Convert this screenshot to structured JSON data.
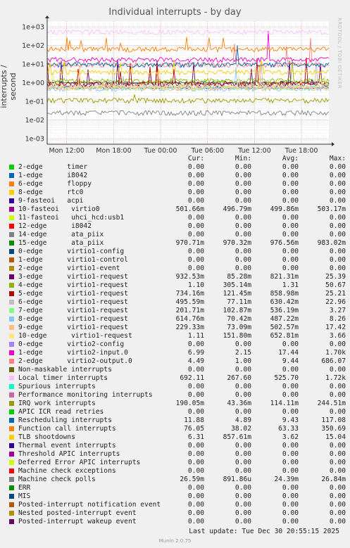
{
  "chart_data": {
    "type": "line",
    "title": "Individual interrupts - by day",
    "ylabel": "interrupts / second",
    "yscale": "log",
    "ylim": [
      0.0005,
      2000
    ],
    "yticks": [
      "1e+03",
      "1e+02",
      "1e+01",
      "1e+00",
      "1e-01",
      "1e-02",
      "1e-03"
    ],
    "ytick_values": [
      1000,
      100,
      10,
      1,
      0.1,
      0.01,
      0.001
    ],
    "xticks": [
      "Mon 12:00",
      "Mon 18:00",
      "Tue 00:00",
      "Tue 06:00",
      "Tue 12:00",
      "Tue 18:00"
    ],
    "xtick_hours": [
      12,
      18,
      24,
      30,
      36,
      42
    ],
    "xlim_hours": [
      9.5,
      45.5
    ],
    "grid": true,
    "legend_position": "bottom",
    "series": [
      {
        "name": "2-edge timer",
        "color": "#00cc00",
        "values": {
          "Cur": "0.00",
          "Min": "0.00",
          "Avg": "0.00",
          "Max": "0.00"
        }
      },
      {
        "name": "1-edge i8042",
        "color": "#0066b3",
        "values": {
          "Cur": "0.00",
          "Min": "0.00",
          "Avg": "0.00",
          "Max": "0.00"
        }
      },
      {
        "name": "6-edge floppy",
        "color": "#ff8000",
        "values": {
          "Cur": "0.00",
          "Min": "0.00",
          "Avg": "0.00",
          "Max": "0.00"
        }
      },
      {
        "name": "8-edge rtc0",
        "color": "#ffcc00",
        "values": {
          "Cur": "0.00",
          "Min": "0.00",
          "Avg": "0.00",
          "Max": "0.00"
        }
      },
      {
        "name": "9-fasteoi acpi",
        "color": "#330099",
        "values": {
          "Cur": "0.00",
          "Min": "0.00",
          "Avg": "0.00",
          "Max": "0.00"
        }
      },
      {
        "name": "10-fasteoi virtio0",
        "color": "#990099",
        "values": {
          "Cur": "501.66m",
          "Min": "496.79m",
          "Avg": "499.86m",
          "Max": "503.17m"
        }
      },
      {
        "name": "11-fasteoi uhci_hcd:usb1",
        "color": "#ccff00",
        "values": {
          "Cur": "0.00",
          "Min": "0.00",
          "Avg": "0.00",
          "Max": "0.00"
        }
      },
      {
        "name": "12-edge i8042",
        "color": "#ff0000",
        "values": {
          "Cur": "0.00",
          "Min": "0.00",
          "Avg": "0.00",
          "Max": "0.00"
        }
      },
      {
        "name": "14-edge ata_piix",
        "color": "#808080",
        "values": {
          "Cur": "0.00",
          "Min": "0.00",
          "Avg": "0.00",
          "Max": "0.00"
        }
      },
      {
        "name": "15-edge ata_piix",
        "color": "#008f00",
        "values": {
          "Cur": "970.71m",
          "Min": "970.32m",
          "Avg": "976.56m",
          "Max": "983.02m"
        }
      },
      {
        "name": "0-edge virtio1-config",
        "color": "#00487d",
        "values": {
          "Cur": "0.00",
          "Min": "0.00",
          "Avg": "0.00",
          "Max": "0.00"
        }
      },
      {
        "name": "1-edge virtio1-control",
        "color": "#b35a00",
        "values": {
          "Cur": "0.00",
          "Min": "0.00",
          "Avg": "0.00",
          "Max": "0.00"
        }
      },
      {
        "name": "2-edge virtio1-event",
        "color": "#b38f00",
        "values": {
          "Cur": "0.00",
          "Min": "0.00",
          "Avg": "0.00",
          "Max": "0.00"
        }
      },
      {
        "name": "3-edge virtio1-request",
        "color": "#6b006b",
        "values": {
          "Cur": "932.53m",
          "Min": "85.28m",
          "Avg": "821.31m",
          "Max": "25.39"
        }
      },
      {
        "name": "4-edge virtio1-request",
        "color": "#8fb300",
        "values": {
          "Cur": "1.10",
          "Min": "305.14m",
          "Avg": "1.31",
          "Max": "50.67"
        }
      },
      {
        "name": "5-edge virtio1-request",
        "color": "#b30000",
        "values": {
          "Cur": "734.16m",
          "Min": "121.45m",
          "Avg": "858.98m",
          "Max": "25.21"
        }
      },
      {
        "name": "6-edge virtio1-request",
        "color": "#bebebe",
        "values": {
          "Cur": "495.59m",
          "Min": "77.11m",
          "Avg": "630.42m",
          "Max": "22.96"
        }
      },
      {
        "name": "7-edge virtio1-request",
        "color": "#80ff80",
        "values": {
          "Cur": "201.71m",
          "Min": "102.87m",
          "Avg": "536.19m",
          "Max": "3.27"
        }
      },
      {
        "name": "8-edge virtio1-request",
        "color": "#80c9ff",
        "values": {
          "Cur": "614.76m",
          "Min": "70.42m",
          "Avg": "487.22m",
          "Max": "8.26"
        }
      },
      {
        "name": "9-edge virtio1-request",
        "color": "#ffc080",
        "values": {
          "Cur": "229.33m",
          "Min": "73.09m",
          "Avg": "502.57m",
          "Max": "17.42"
        }
      },
      {
        "name": "10-edge virtio1-request",
        "color": "#ffe680",
        "values": {
          "Cur": "1.11",
          "Min": "151.80m",
          "Avg": "652.81m",
          "Max": "3.66"
        }
      },
      {
        "name": "0-edge virtio2-config",
        "color": "#aa80ff",
        "values": {
          "Cur": "0.00",
          "Min": "0.00",
          "Avg": "0.00",
          "Max": "0.00"
        }
      },
      {
        "name": "1-edge virtio2-input.0",
        "color": "#ee00cc",
        "values": {
          "Cur": "6.99",
          "Min": "2.15",
          "Avg": "17.44",
          "Max": "1.70k"
        }
      },
      {
        "name": "2-edge virtio2-output.0",
        "color": "#ff8080",
        "values": {
          "Cur": "4.49",
          "Min": "1.00",
          "Avg": "9.44",
          "Max": "686.07"
        }
      },
      {
        "name": "Non-maskable interrupts",
        "color": "#666600",
        "values": {
          "Cur": "0.00",
          "Min": "0.00",
          "Avg": "0.00",
          "Max": "0.00"
        }
      },
      {
        "name": "Local timer interrupts",
        "color": "#ffbfff",
        "values": {
          "Cur": "692.11",
          "Min": "267.60",
          "Avg": "525.70",
          "Max": "1.72k"
        }
      },
      {
        "name": "Spurious interrupts",
        "color": "#00ffcc",
        "values": {
          "Cur": "0.00",
          "Min": "0.00",
          "Avg": "0.00",
          "Max": "0.00"
        }
      },
      {
        "name": "Performance monitoring interrupts",
        "color": "#cc6699",
        "values": {
          "Cur": "0.00",
          "Min": "0.00",
          "Avg": "0.00",
          "Max": "0.00"
        }
      },
      {
        "name": "IRQ work interrupts",
        "color": "#999900",
        "values": {
          "Cur": "190.05m",
          "Min": "43.36m",
          "Avg": "114.11m",
          "Max": "244.51m"
        }
      },
      {
        "name": "APIC ICR read retries",
        "color": "#00cc00",
        "values": {
          "Cur": "0.00",
          "Min": "0.00",
          "Avg": "0.00",
          "Max": "0.00"
        }
      },
      {
        "name": "Rescheduling interrupts",
        "color": "#0066b3",
        "values": {
          "Cur": "11.88",
          "Min": "4.89",
          "Avg": "9.43",
          "Max": "117.08"
        }
      },
      {
        "name": "Function call interrupts",
        "color": "#ff8000",
        "values": {
          "Cur": "76.05",
          "Min": "38.02",
          "Avg": "63.33",
          "Max": "350.69"
        }
      },
      {
        "name": "TLB shootdowns",
        "color": "#ffcc00",
        "values": {
          "Cur": "6.31",
          "Min": "857.61m",
          "Avg": "3.62",
          "Max": "15.04"
        }
      },
      {
        "name": "Thermal event interrupts",
        "color": "#330099",
        "values": {
          "Cur": "0.00",
          "Min": "0.00",
          "Avg": "0.00",
          "Max": "0.00"
        }
      },
      {
        "name": "Threshold APIC interrupts",
        "color": "#990099",
        "values": {
          "Cur": "0.00",
          "Min": "0.00",
          "Avg": "0.00",
          "Max": "0.00"
        }
      },
      {
        "name": "Deferred Error APIC interrupts",
        "color": "#ccff00",
        "values": {
          "Cur": "0.00",
          "Min": "0.00",
          "Avg": "0.00",
          "Max": "0.00"
        }
      },
      {
        "name": "Machine check exceptions",
        "color": "#ff0000",
        "values": {
          "Cur": "0.00",
          "Min": "0.00",
          "Avg": "0.00",
          "Max": "0.00"
        }
      },
      {
        "name": "Machine check polls",
        "color": "#808080",
        "values": {
          "Cur": "26.59m",
          "Min": "891.86u",
          "Avg": "24.39m",
          "Max": "26.84m"
        }
      },
      {
        "name": "ERR",
        "color": "#008f00",
        "values": {
          "Cur": "0.00",
          "Min": "0.00",
          "Avg": "0.00",
          "Max": "0.00"
        }
      },
      {
        "name": "MIS",
        "color": "#00487d",
        "values": {
          "Cur": "0.00",
          "Min": "0.00",
          "Avg": "0.00",
          "Max": "0.00"
        }
      },
      {
        "name": "Posted-interrupt notification event",
        "color": "#b35a00",
        "values": {
          "Cur": "0.00",
          "Min": "0.00",
          "Avg": "0.00",
          "Max": "0.00"
        }
      },
      {
        "name": "Nested posted-interrupt event",
        "color": "#b38f00",
        "values": {
          "Cur": "0.00",
          "Min": "0.00",
          "Avg": "0.00",
          "Max": "0.00"
        }
      },
      {
        "name": "Posted-interrupt wakeup event",
        "color": "#6b006b",
        "values": {
          "Cur": "0.00",
          "Min": "0.00",
          "Avg": "0.00",
          "Max": "0.00"
        }
      }
    ]
  },
  "legend": {
    "columns": [
      "Cur:",
      "Min:",
      "Avg:",
      "Max:"
    ],
    "rows": [
      {
        "label": "2-edge      timer",
        "color": "#00cc00",
        "cur": "0.00",
        "min": "0.00",
        "avg": "0.00",
        "max": "0.00"
      },
      {
        "label": "1-edge      i8042",
        "color": "#0066b3",
        "cur": "0.00",
        "min": "0.00",
        "avg": "0.00",
        "max": "0.00"
      },
      {
        "label": "6-edge      floppy",
        "color": "#ff8000",
        "cur": "0.00",
        "min": "0.00",
        "avg": "0.00",
        "max": "0.00"
      },
      {
        "label": "8-edge      rtc0",
        "color": "#ffcc00",
        "cur": "0.00",
        "min": "0.00",
        "avg": "0.00",
        "max": "0.00"
      },
      {
        "label": "9-fasteoi   acpi",
        "color": "#330099",
        "cur": "0.00",
        "min": "0.00",
        "avg": "0.00",
        "max": "0.00"
      },
      {
        "label": "10-fasteoi   virtio0",
        "color": "#990099",
        "cur": "501.66m",
        "min": "496.79m",
        "avg": "499.86m",
        "max": "503.17m"
      },
      {
        "label": "11-fasteoi   uhci_hcd:usb1",
        "color": "#ccff00",
        "cur": "0.00",
        "min": "0.00",
        "avg": "0.00",
        "max": "0.00"
      },
      {
        "label": "12-edge      i8042",
        "color": "#ff0000",
        "cur": "0.00",
        "min": "0.00",
        "avg": "0.00",
        "max": "0.00"
      },
      {
        "label": "14-edge      ata_piix",
        "color": "#808080",
        "cur": "0.00",
        "min": "0.00",
        "avg": "0.00",
        "max": "0.00"
      },
      {
        "label": "15-edge      ata_piix",
        "color": "#008f00",
        "cur": "970.71m",
        "min": "970.32m",
        "avg": "976.56m",
        "max": "983.02m"
      },
      {
        "label": "0-edge      virtio1-config",
        "color": "#00487d",
        "cur": "0.00",
        "min": "0.00",
        "avg": "0.00",
        "max": "0.00"
      },
      {
        "label": "1-edge      virtio1-control",
        "color": "#b35a00",
        "cur": "0.00",
        "min": "0.00",
        "avg": "0.00",
        "max": "0.00"
      },
      {
        "label": "2-edge      virtio1-event",
        "color": "#b38f00",
        "cur": "0.00",
        "min": "0.00",
        "avg": "0.00",
        "max": "0.00"
      },
      {
        "label": "3-edge      virtio1-request",
        "color": "#6b006b",
        "cur": "932.53m",
        "min": "85.28m",
        "avg": "821.31m",
        "max": "25.39"
      },
      {
        "label": "4-edge      virtio1-request",
        "color": "#8fb300",
        "cur": "1.10",
        "min": "305.14m",
        "avg": "1.31",
        "max": "50.67"
      },
      {
        "label": "5-edge      virtio1-request",
        "color": "#b30000",
        "cur": "734.16m",
        "min": "121.45m",
        "avg": "858.98m",
        "max": "25.21"
      },
      {
        "label": "6-edge      virtio1-request",
        "color": "#bebebe",
        "cur": "495.59m",
        "min": "77.11m",
        "avg": "630.42m",
        "max": "22.96"
      },
      {
        "label": "7-edge      virtio1-request",
        "color": "#80ff80",
        "cur": "201.71m",
        "min": "102.87m",
        "avg": "536.19m",
        "max": "3.27"
      },
      {
        "label": "8-edge      virtio1-request",
        "color": "#80c9ff",
        "cur": "614.76m",
        "min": "70.42m",
        "avg": "487.22m",
        "max": "8.26"
      },
      {
        "label": "9-edge      virtio1-request",
        "color": "#ffc080",
        "cur": "229.33m",
        "min": "73.09m",
        "avg": "502.57m",
        "max": "17.42"
      },
      {
        "label": "10-edge      virtio1-request",
        "color": "#ffe680",
        "cur": "1.11",
        "min": "151.80m",
        "avg": "652.81m",
        "max": "3.66"
      },
      {
        "label": "0-edge      virtio2-config",
        "color": "#aa80ff",
        "cur": "0.00",
        "min": "0.00",
        "avg": "0.00",
        "max": "0.00"
      },
      {
        "label": "1-edge      virtio2-input.0",
        "color": "#ee00cc",
        "cur": "6.99",
        "min": "2.15",
        "avg": "17.44",
        "max": "1.70k"
      },
      {
        "label": "2-edge      virtio2-output.0",
        "color": "#ff8080",
        "cur": "4.49",
        "min": "1.00",
        "avg": "9.44",
        "max": "686.07"
      },
      {
        "label": "Non-maskable interrupts",
        "color": "#666600",
        "cur": "0.00",
        "min": "0.00",
        "avg": "0.00",
        "max": "0.00"
      },
      {
        "label": "Local timer interrupts",
        "color": "#ffbfff",
        "cur": "692.11",
        "min": "267.60",
        "avg": "525.70",
        "max": "1.72k"
      },
      {
        "label": "Spurious interrupts",
        "color": "#00ffcc",
        "cur": "0.00",
        "min": "0.00",
        "avg": "0.00",
        "max": "0.00"
      },
      {
        "label": "Performance monitoring interrupts",
        "color": "#cc6699",
        "cur": "0.00",
        "min": "0.00",
        "avg": "0.00",
        "max": "0.00"
      },
      {
        "label": "IRQ work interrupts",
        "color": "#999900",
        "cur": "190.05m",
        "min": "43.36m",
        "avg": "114.11m",
        "max": "244.51m"
      },
      {
        "label": "APIC ICR read retries",
        "color": "#00cc00",
        "cur": "0.00",
        "min": "0.00",
        "avg": "0.00",
        "max": "0.00"
      },
      {
        "label": "Rescheduling interrupts",
        "color": "#0066b3",
        "cur": "11.88",
        "min": "4.89",
        "avg": "9.43",
        "max": "117.08"
      },
      {
        "label": "Function call interrupts",
        "color": "#ff8000",
        "cur": "76.05",
        "min": "38.02",
        "avg": "63.33",
        "max": "350.69"
      },
      {
        "label": "TLB shootdowns",
        "color": "#ffcc00",
        "cur": "6.31",
        "min": "857.61m",
        "avg": "3.62",
        "max": "15.04"
      },
      {
        "label": "Thermal event interrupts",
        "color": "#330099",
        "cur": "0.00",
        "min": "0.00",
        "avg": "0.00",
        "max": "0.00"
      },
      {
        "label": "Threshold APIC interrupts",
        "color": "#990099",
        "cur": "0.00",
        "min": "0.00",
        "avg": "0.00",
        "max": "0.00"
      },
      {
        "label": "Deferred Error APIC interrupts",
        "color": "#ccff00",
        "cur": "0.00",
        "min": "0.00",
        "avg": "0.00",
        "max": "0.00"
      },
      {
        "label": "Machine check exceptions",
        "color": "#ff0000",
        "cur": "0.00",
        "min": "0.00",
        "avg": "0.00",
        "max": "0.00"
      },
      {
        "label": "Machine check polls",
        "color": "#808080",
        "cur": "26.59m",
        "min": "891.86u",
        "avg": "24.39m",
        "max": "26.84m"
      },
      {
        "label": "ERR",
        "color": "#008f00",
        "cur": "0.00",
        "min": "0.00",
        "avg": "0.00",
        "max": "0.00"
      },
      {
        "label": "MIS",
        "color": "#00487d",
        "cur": "0.00",
        "min": "0.00",
        "avg": "0.00",
        "max": "0.00"
      },
      {
        "label": "Posted-interrupt notification event",
        "color": "#b35a00",
        "cur": "0.00",
        "min": "0.00",
        "avg": "0.00",
        "max": "0.00"
      },
      {
        "label": "Nested posted-interrupt event",
        "color": "#b38f00",
        "cur": "0.00",
        "min": "0.00",
        "avg": "0.00",
        "max": "0.00"
      },
      {
        "label": "Posted-interrupt wakeup event",
        "color": "#6b006b",
        "cur": "0.00",
        "min": "0.00",
        "avg": "0.00",
        "max": "0.00"
      }
    ]
  },
  "footer": {
    "last_update": "Last update: Tue Dec 30 20:55:15 2025",
    "generator": "Munin 2.0.75",
    "credit": "RRDTOOL / TOBI OETIKER"
  }
}
